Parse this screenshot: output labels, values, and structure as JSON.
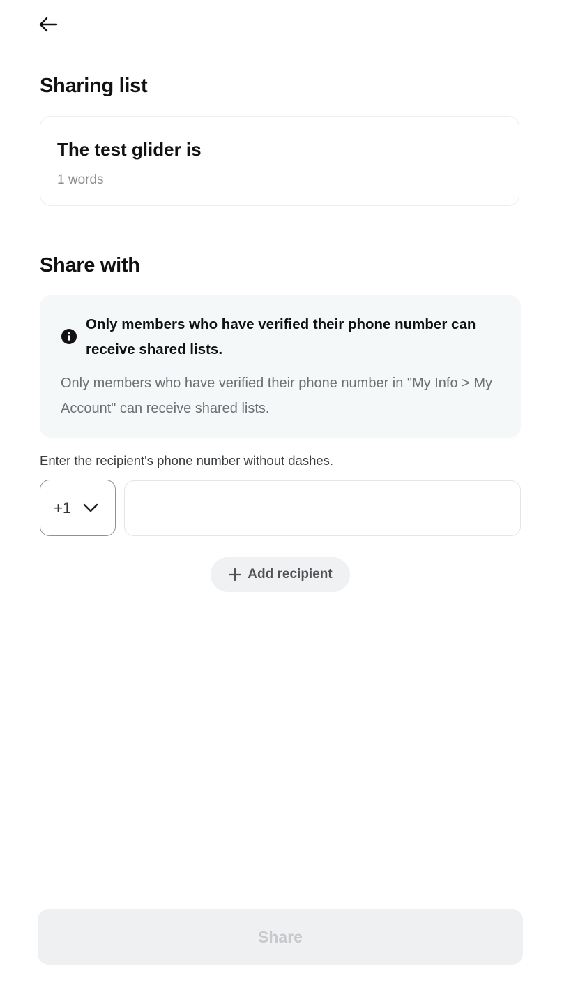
{
  "header": {
    "back_icon": "arrow-left-icon"
  },
  "sharing_list": {
    "title": "Sharing list",
    "list_name": "The test glider is",
    "word_count": "1 words"
  },
  "share_with": {
    "title": "Share with",
    "notice": {
      "icon": "info-icon",
      "title": "Only members who have verified their phone number can receive shared lists.",
      "body": "Only members who have verified their phone number in \"My Info > My Account\" can receive shared lists."
    },
    "phone_hint": "Enter the recipient's phone number without dashes.",
    "country_code": "+1",
    "phone_value": "",
    "add_recipient_label": "Add recipient"
  },
  "footer": {
    "share_label": "Share"
  },
  "colors": {
    "notice_bg": "#f5f8f9",
    "button_bg": "#eff1f3",
    "disabled_text": "#c7c9cc"
  }
}
